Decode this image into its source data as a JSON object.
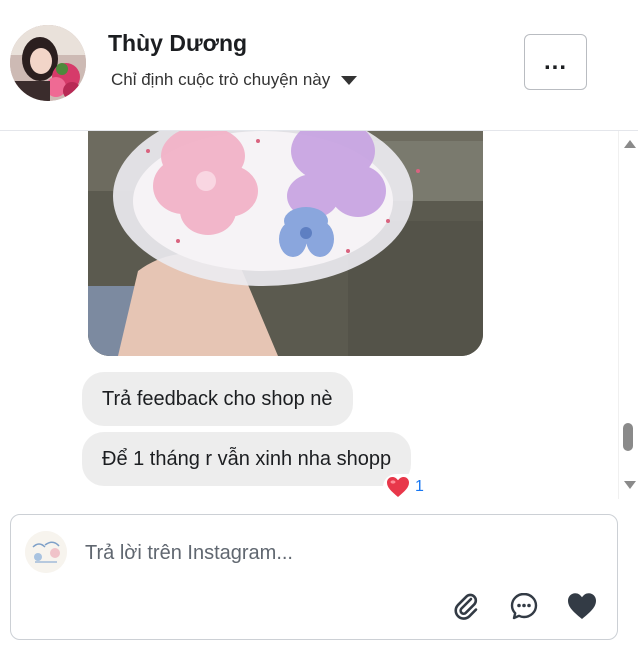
{
  "header": {
    "contact_name": "Thùy Dương",
    "assign_label": "Chỉ định cuộc trò chuyện này",
    "more_label": "..."
  },
  "messages": [
    {
      "type": "image",
      "description": ""
    },
    {
      "type": "text",
      "text": "Trả feedback cho shop nè"
    },
    {
      "type": "text",
      "text": "Để 1 tháng r vẫn xinh nha shopp",
      "reaction": {
        "icon": "heart-emoji",
        "count": "1"
      }
    }
  ],
  "composer": {
    "placeholder": "Trả lời trên Instagram...",
    "value": ""
  },
  "icons": {
    "attach": "paperclip-icon",
    "saved_replies": "chat-bubble-icon",
    "like": "heart-icon"
  },
  "colors": {
    "bubble": "#ededed",
    "reaction_count": "#1877f2",
    "icon": "#333b45",
    "reaction_heart": "#e8374a"
  }
}
